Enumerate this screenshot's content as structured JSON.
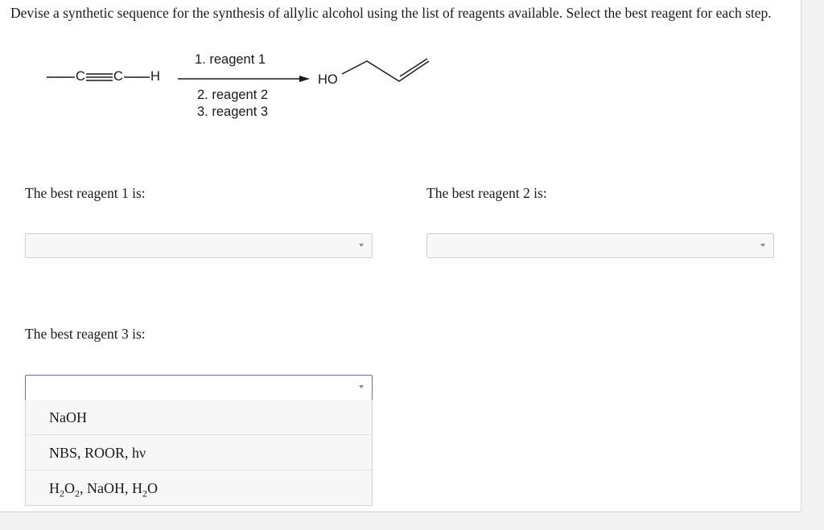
{
  "question": {
    "text": "Devise a synthetic sequence for the synthesis of allylic alcohol using the list of reagents available. Select the best reagent for each step."
  },
  "scheme": {
    "reactant": {
      "c1": "C",
      "c2": "C",
      "h": "H"
    },
    "step1": "1. reagent 1",
    "step2": "2. reagent 2",
    "step3": "3. reagent 3",
    "product_label": "HO"
  },
  "prompts": {
    "reagent1": "The best reagent 1 is:",
    "reagent2": "The best reagent 2 is:",
    "reagent3": "The best reagent 3 is:"
  },
  "selects": {
    "reagent1": {
      "value": ""
    },
    "reagent2": {
      "value": ""
    },
    "reagent3": {
      "value": "",
      "open": true
    }
  },
  "dropdown_options": [
    {
      "label": "NaOH"
    },
    {
      "label": "NBS, ROOR, hν"
    },
    {
      "formula_parts": [
        "H",
        "2",
        "O",
        "2",
        ", NaOH, H",
        "2",
        "O"
      ]
    }
  ],
  "icons": {
    "caret": "caret-down-icon"
  },
  "colors": {
    "open_border": "#6b6fa3",
    "select_bg": "#f7f7f7"
  }
}
